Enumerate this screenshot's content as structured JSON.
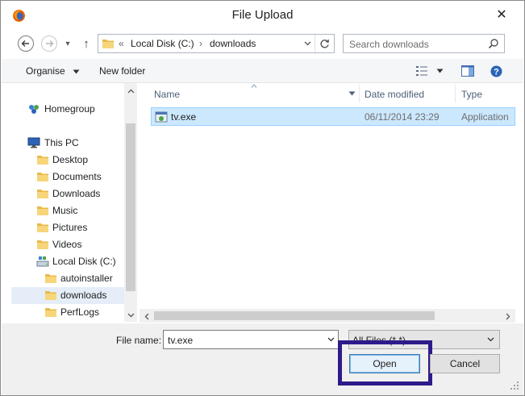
{
  "window": {
    "title": "File Upload",
    "close_glyph": "✕"
  },
  "nav": {
    "back_glyph": "←",
    "forward_glyph": "→",
    "recent_glyph": "▾",
    "up_glyph": "↑",
    "breadcrumb_prefix": "«",
    "path": [
      "Local Disk (C:)",
      "downloads"
    ],
    "path_sep": "›",
    "search_placeholder": "Search downloads"
  },
  "toolbar": {
    "organise_label": "Organise",
    "new_folder_label": "New folder"
  },
  "sidebar": {
    "items": [
      {
        "label": "Homegroup",
        "icon": "homegroup-icon"
      },
      {
        "label": "This PC",
        "icon": "computer-icon"
      },
      {
        "label": "Desktop",
        "icon": "folder-icon"
      },
      {
        "label": "Documents",
        "icon": "folder-icon"
      },
      {
        "label": "Downloads",
        "icon": "folder-icon"
      },
      {
        "label": "Music",
        "icon": "folder-icon"
      },
      {
        "label": "Pictures",
        "icon": "folder-icon"
      },
      {
        "label": "Videos",
        "icon": "folder-icon"
      },
      {
        "label": "Local Disk (C:)",
        "icon": "drive-icon"
      },
      {
        "label": "autoinstaller",
        "icon": "folder-icon"
      },
      {
        "label": "downloads",
        "icon": "folder-icon",
        "selected": true
      },
      {
        "label": "PerfLogs",
        "icon": "folder-icon"
      }
    ]
  },
  "files": {
    "columns": [
      "Name",
      "Date modified",
      "Type"
    ],
    "rows": [
      {
        "name": "tv.exe",
        "date": "06/11/2014 23:29",
        "type": "Application",
        "selected": true
      }
    ]
  },
  "bottom": {
    "file_name_label": "File name:",
    "file_name_value": "tv.exe",
    "filter_value": "All Files (*.*)",
    "open_label": "Open",
    "cancel_label": "Cancel"
  },
  "colors": {
    "highlight_box": "#2e1a8a",
    "selection": "#cce8ff",
    "folder": "#f0c560"
  }
}
